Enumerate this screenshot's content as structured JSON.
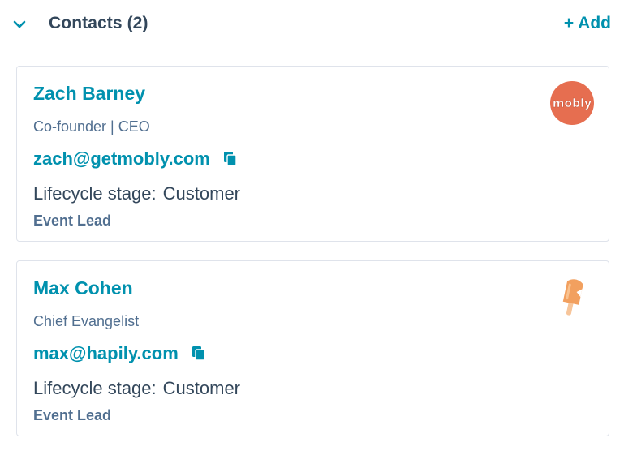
{
  "section": {
    "title": "Contacts (2)",
    "add_label": "+ Add",
    "accent_color": "#0091ae"
  },
  "contacts": [
    {
      "name": "Zach Barney",
      "title": "Co-founder | CEO",
      "email": "zach@getmobly.com",
      "lifecycle_label": "Lifecycle stage:",
      "lifecycle_value": "Customer",
      "lead_status": "Event Lead",
      "logo": {
        "icon": "mobly-logo",
        "text": "mobly",
        "color": "#e66e50"
      }
    },
    {
      "name": "Max Cohen",
      "title": "Chief Evangelist",
      "email": "max@hapily.com",
      "lifecycle_label": "Lifecycle stage:",
      "lifecycle_value": "Customer",
      "lead_status": "Event Lead",
      "logo": {
        "icon": "popsicle-logo",
        "color": "#f2a05f"
      }
    }
  ]
}
